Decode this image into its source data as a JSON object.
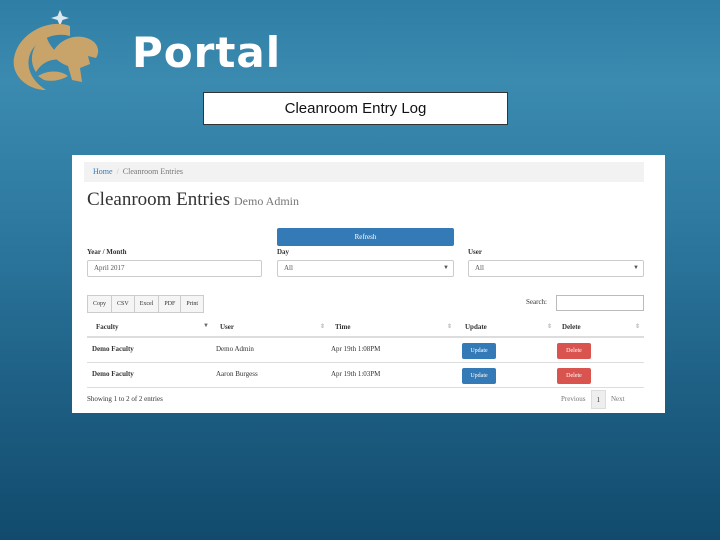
{
  "header": {
    "title": "Portal",
    "subtitle": "Cleanroom Entry Log"
  },
  "colors": {
    "primary": "#337ab7",
    "danger": "#d9534f",
    "bg": "#2e7aa1",
    "logo_gold": "#c8a46a"
  },
  "app": {
    "breadcrumb": {
      "home": "Home",
      "sep": "/",
      "current": "Cleanroom Entries"
    },
    "page_title": "Cleanroom Entries",
    "page_subtitle": "Demo Admin",
    "refresh_label": "Refresh",
    "filters": {
      "month": {
        "label": "Year / Month",
        "value": "April 2017"
      },
      "day": {
        "label": "Day",
        "value": "All"
      },
      "user": {
        "label": "User",
        "value": "All"
      }
    },
    "export_buttons": [
      "Copy",
      "CSV",
      "Excel",
      "PDF",
      "Print"
    ],
    "search_label": "Search:",
    "columns": [
      "Faculty",
      "User",
      "Time",
      "Update",
      "Delete"
    ],
    "rows": [
      {
        "faculty": "Demo Faculty",
        "user": "Demo Admin",
        "time": "Apr 19th 1:08PM",
        "update": "Update",
        "delete": "Delete"
      },
      {
        "faculty": "Demo Faculty",
        "user": "Aaron Burgess",
        "time": "Apr 19th 1:03PM",
        "update": "Update",
        "delete": "Delete"
      }
    ],
    "info": "Showing 1 to 2 of 2 entries",
    "pager": {
      "prev": "Previous",
      "current": "1",
      "next": "Next"
    }
  }
}
